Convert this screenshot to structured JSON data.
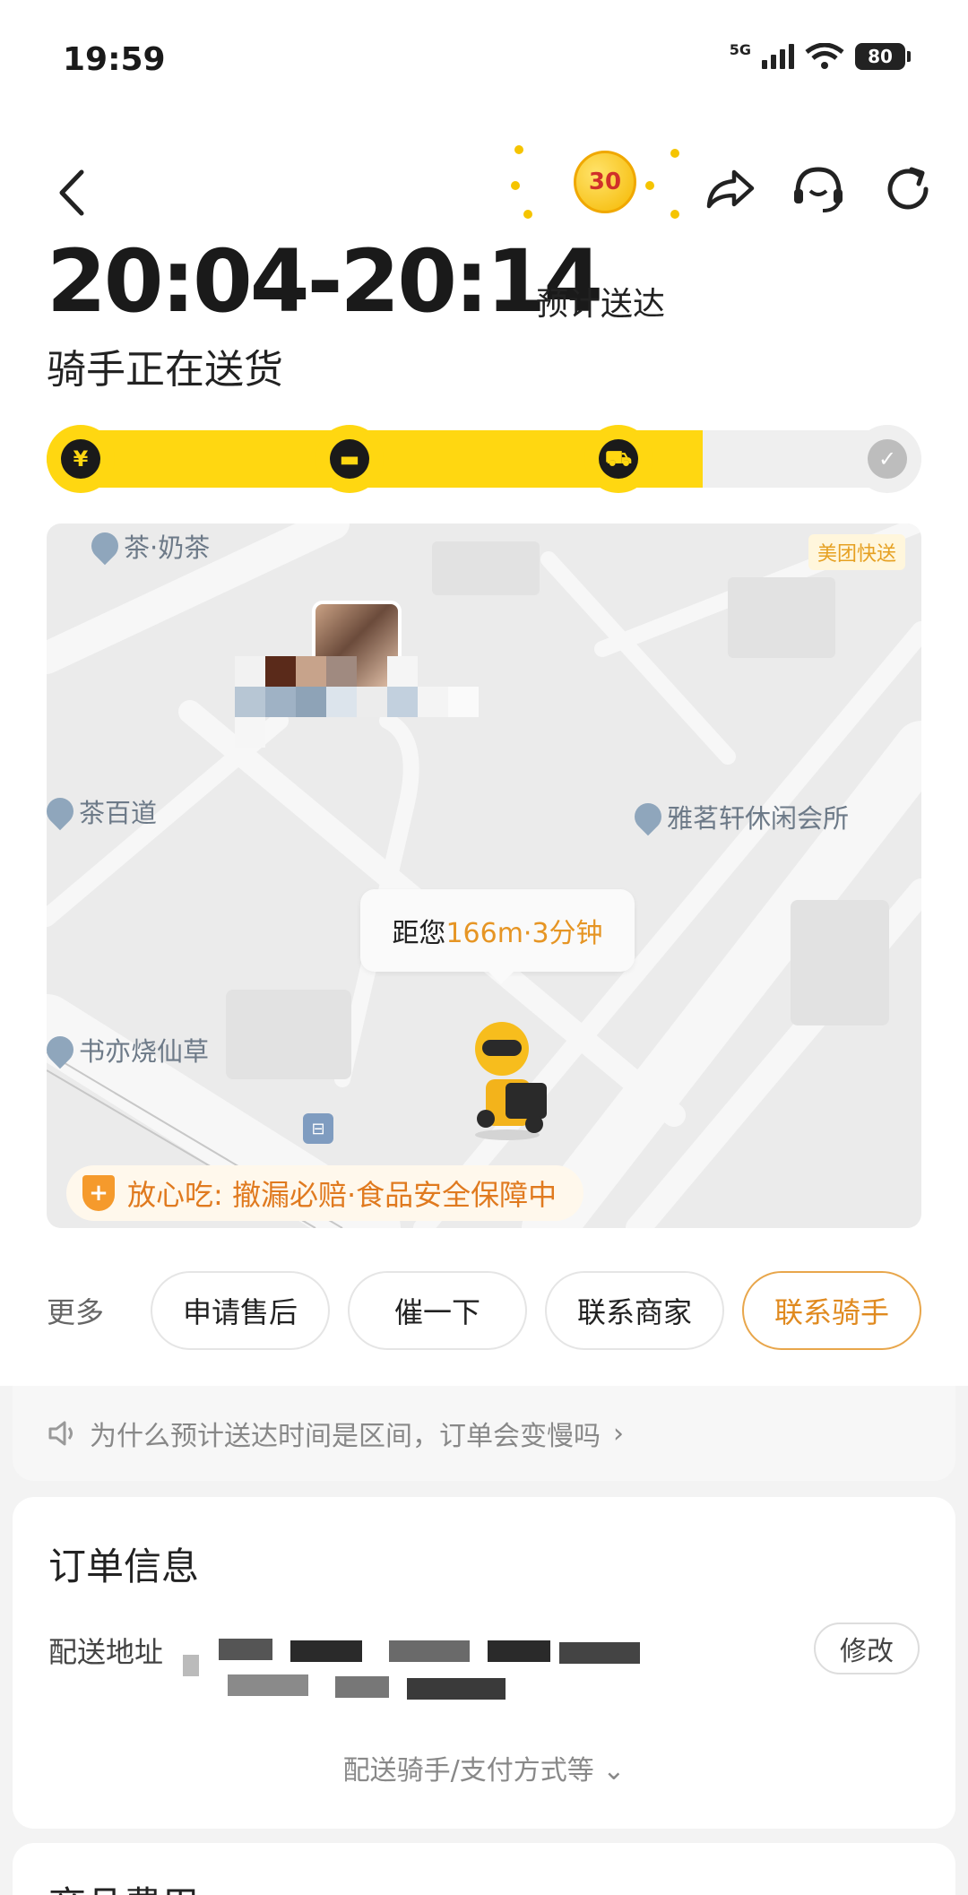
{
  "status_bar": {
    "time": "19:59",
    "network": "5G",
    "battery": "80"
  },
  "header": {
    "coin_value": "30",
    "eta_range": "20:04-20:14",
    "eta_suffix": "预计送达",
    "status_text": "骑手正在送货"
  },
  "progress": {
    "fraction_complete": 0.75,
    "steps": [
      {
        "name": "paid",
        "glyph": "¥",
        "done": true
      },
      {
        "name": "merchant",
        "glyph": "▬",
        "done": true
      },
      {
        "name": "delivering",
        "glyph": "⛟",
        "done": true
      },
      {
        "name": "arrived",
        "glyph": "✓",
        "done": false
      }
    ],
    "colors": {
      "fill": "#ffd711",
      "track": "#efefef"
    }
  },
  "map": {
    "pois": [
      "茶·奶茶",
      "茶百道",
      "雅茗轩休闲会所",
      "书亦烧仙草"
    ],
    "tag": "美团快送",
    "distance_prefix": "距您",
    "distance_value": "166m·3分钟",
    "safety_text": "放心吃: 撤漏必赔·食品安全保障中",
    "bus_glyph": "⊟"
  },
  "actions": {
    "more": "更多",
    "buttons": [
      "申请售后",
      "催一下",
      "联系商家",
      "联系骑手"
    ]
  },
  "tip": {
    "text": "为什么预计送达时间是区间，订单会变慢吗",
    "chevron": "›"
  },
  "order": {
    "title": "订单信息",
    "address_label": "配送地址",
    "edit_label": "修改",
    "expand_text": "配送骑手/支付方式等",
    "expand_chevron": "⌄"
  },
  "next_section": {
    "title": "商品费用"
  },
  "accent_colors": {
    "brand_yellow": "#ffd711",
    "orange": "#e08a1f"
  }
}
